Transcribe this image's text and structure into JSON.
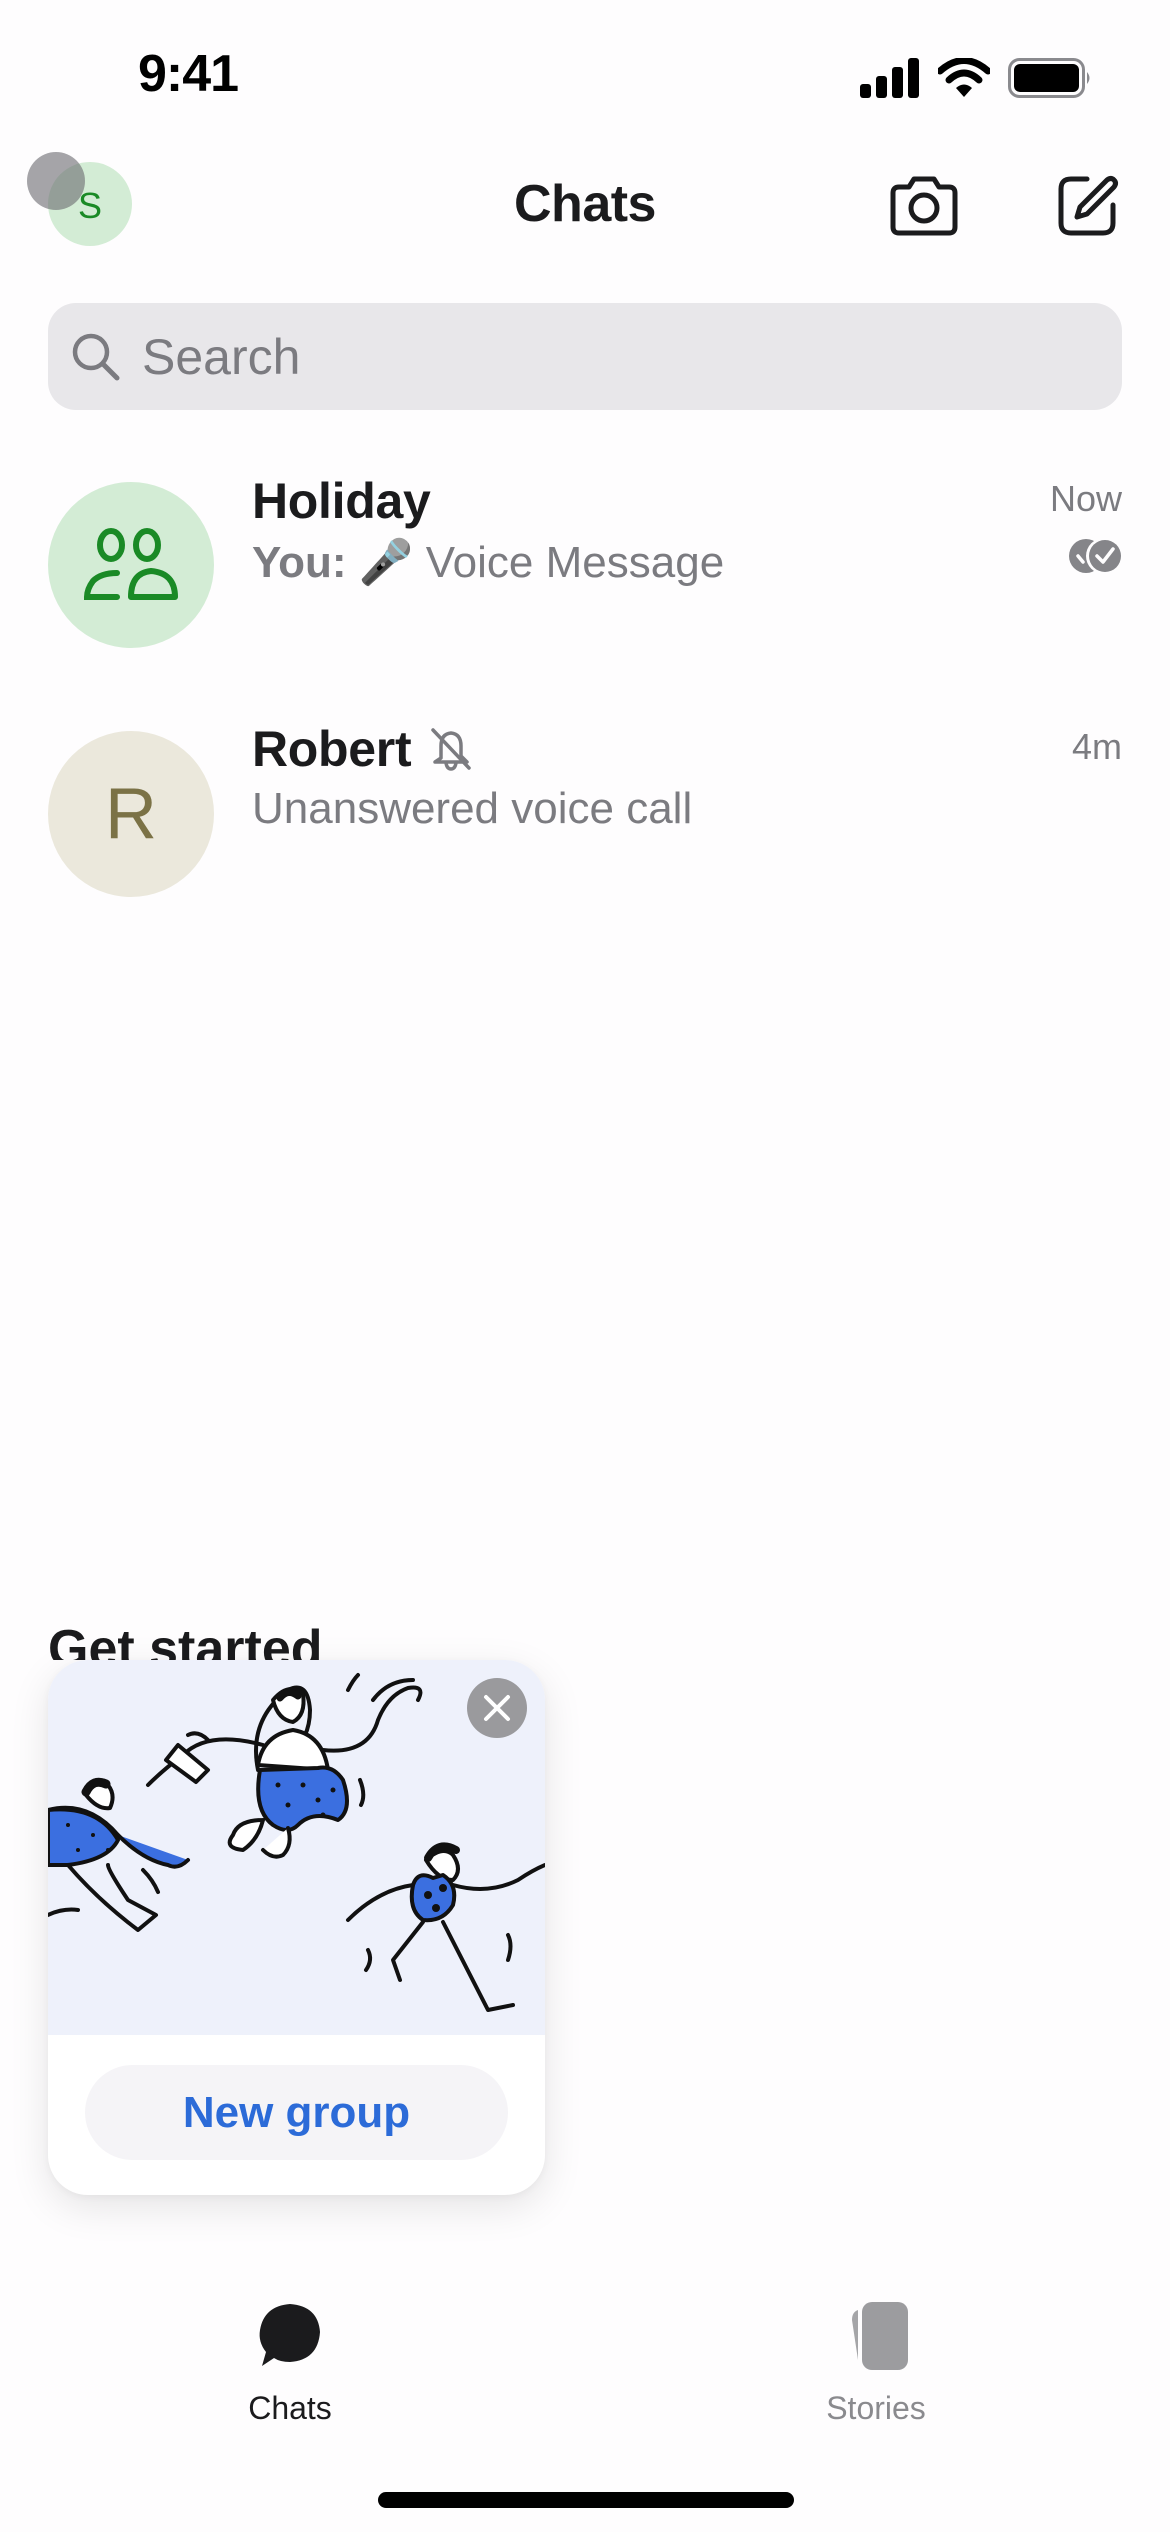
{
  "status_bar": {
    "time": "9:41",
    "icons": [
      "cellular-signal-icon",
      "wifi-icon",
      "battery-icon"
    ]
  },
  "header": {
    "profile_initial": "S",
    "title": "Chats",
    "actions": [
      {
        "name": "camera-button",
        "icon": "camera-icon"
      },
      {
        "name": "compose-button",
        "icon": "compose-icon"
      }
    ]
  },
  "search": {
    "placeholder": "Search",
    "value": ""
  },
  "chats": [
    {
      "name": "Holiday",
      "avatar_type": "group",
      "avatar_icon": "group-icon",
      "preview_sender": "You:",
      "preview_emoji": "🎤",
      "preview_text": "Voice Message",
      "time": "Now",
      "status_icon": "delivered-icon",
      "muted": false,
      "avatar_bg": "#d3ecd5",
      "avatar_fg": "#1a8a26"
    },
    {
      "name": "Robert",
      "avatar_type": "initial",
      "avatar_initial": "R",
      "preview_text": "Unanswered voice call",
      "time": "4m",
      "muted": true,
      "muted_icon": "bell-slash-icon",
      "avatar_bg": "#ebe8dc",
      "avatar_fg": "#7b7246"
    }
  ],
  "get_started": {
    "title": "Get started",
    "card": {
      "illustration": "people-jumping-illustration",
      "close_icon": "close-icon",
      "button_label": "New group"
    }
  },
  "tab_bar": {
    "tabs": [
      {
        "label": "Chats",
        "icon": "chat-bubble-icon",
        "active": true
      },
      {
        "label": "Stories",
        "icon": "stories-icon",
        "active": false
      }
    ]
  },
  "colors": {
    "accent": "#2c6bd8",
    "text_primary": "#1b1b1d",
    "text_secondary": "#7b7b80",
    "search_bg": "#e8e7ea",
    "illustration_blue": "#3b6fe0"
  }
}
